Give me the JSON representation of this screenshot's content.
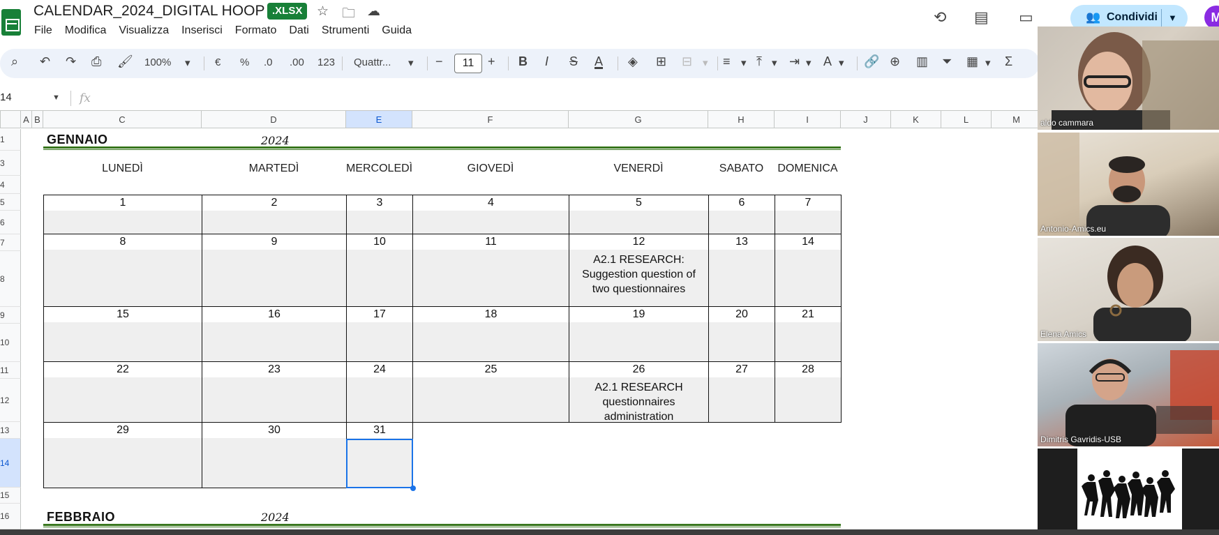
{
  "doc": {
    "title": "CALENDAR_2024_DIGITAL HOOP",
    "badge": ".XLSX"
  },
  "menu": [
    "File",
    "Modifica",
    "Visualizza",
    "Inserisci",
    "Formato",
    "Dati",
    "Strumenti",
    "Guida"
  ],
  "share": {
    "label": "Condividi",
    "avatar_initial": "M"
  },
  "toolbar": {
    "zoom": "100%",
    "currency": "€",
    "percent": "%",
    "dec_decrease": ".0",
    "dec_increase": ".00",
    "number_format": "123",
    "font": "Quattr...",
    "font_size": "11",
    "minus": "−",
    "plus": "+",
    "bold": "B",
    "italic": "I",
    "strike": "S",
    "text_color": "A",
    "text_rotate": "A",
    "sum": "Σ"
  },
  "formula_bar": {
    "cell_ref": "14",
    "fx": "fx",
    "value": ""
  },
  "columns": [
    "A",
    "B",
    "C",
    "D",
    "E",
    "F",
    "G",
    "H",
    "I",
    "J",
    "K",
    "L",
    "M"
  ],
  "selected_column": "E",
  "rows": [
    "1",
    "3",
    "4",
    "5",
    "6",
    "7",
    "8",
    "9",
    "10",
    "11",
    "12",
    "13",
    "14",
    "15",
    "16"
  ],
  "selected_row": "14",
  "calendar": {
    "month": "GENNAIO",
    "year": "2024",
    "next_month": "FEBBRAIO",
    "next_year": "2024",
    "days": [
      "LUNEDÌ",
      "MARTEDÌ",
      "MERCOLEDÌ",
      "GIOVEDÌ",
      "VENERDÌ",
      "SABATO",
      "DOMENICA"
    ],
    "weeks": [
      [
        "1",
        "2",
        "3",
        "4",
        "5",
        "6",
        "7"
      ],
      [
        "8",
        "9",
        "10",
        "11",
        "12",
        "13",
        "14"
      ],
      [
        "15",
        "16",
        "17",
        "18",
        "19",
        "20",
        "21"
      ],
      [
        "22",
        "23",
        "24",
        "25",
        "26",
        "27",
        "28"
      ],
      [
        "29",
        "30",
        "31"
      ]
    ],
    "events": {
      "12": [
        "A2.1 RESEARCH:",
        "Suggestion question of",
        "two questionnaires"
      ],
      "26": [
        "A2.1 RESEARCH",
        "questionnaires",
        "administration"
      ]
    }
  },
  "participants": [
    {
      "name": "aldo cammara"
    },
    {
      "name": "Antonio-Amics.eu"
    },
    {
      "name": "Elena Amics"
    },
    {
      "name": "Dimitris Gavridis-USB"
    },
    {
      "name": ""
    }
  ],
  "colors": {
    "accent_green": "#188038",
    "line_green": "#38761d",
    "share_bg": "#c2e7ff",
    "selection": "#1a73e8"
  }
}
